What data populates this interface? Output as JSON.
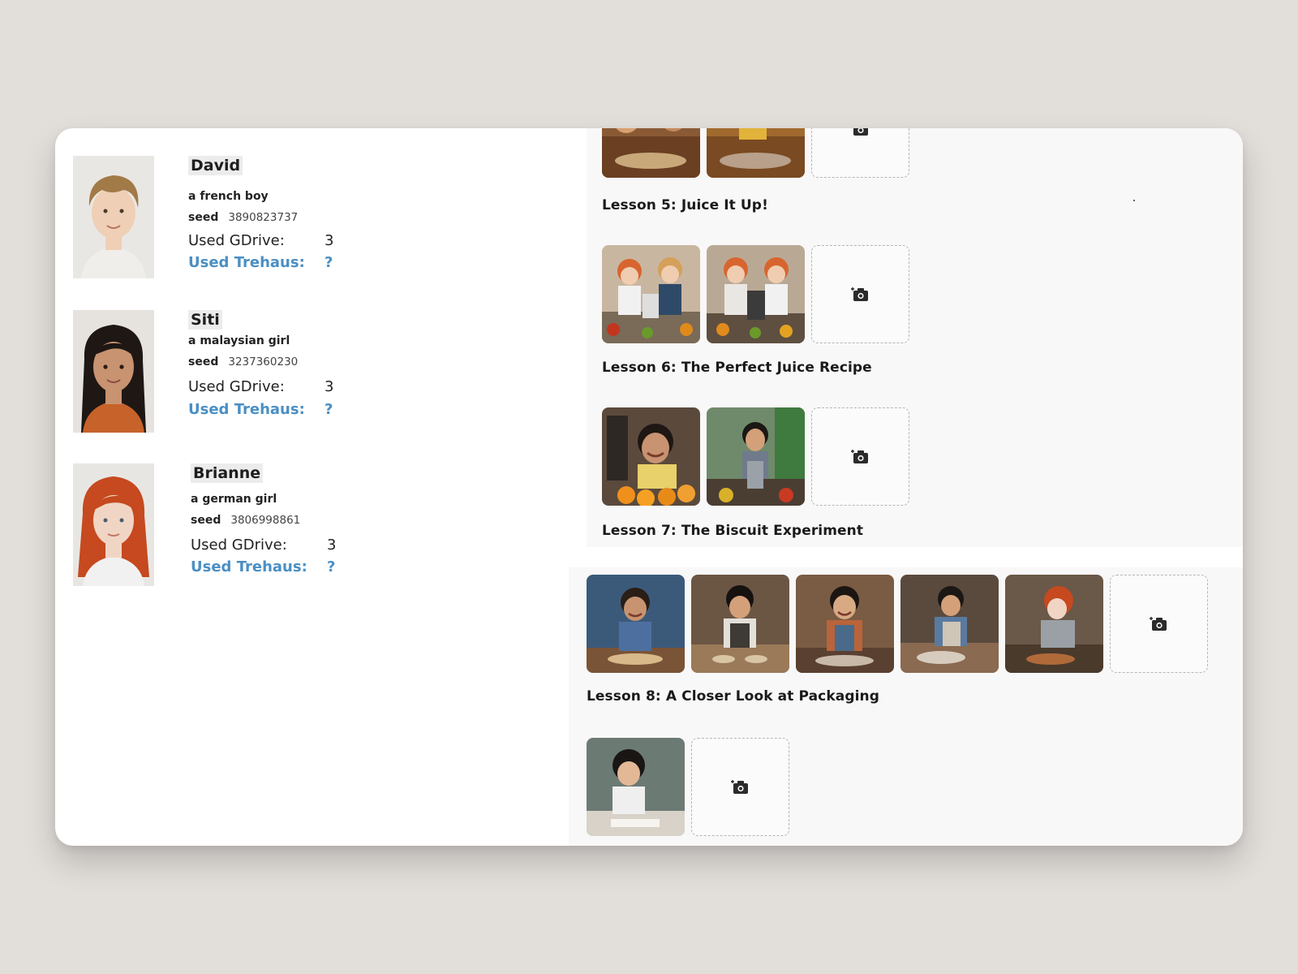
{
  "characters": [
    {
      "name": "David",
      "description": "a french boy",
      "seed_label": "seed",
      "seed": "3890823737",
      "gdrive_label": "Used GDrive:",
      "gdrive_count": "3",
      "trehaus_label": "Used Trehaus:",
      "trehaus_count": "?",
      "portrait_hair": "#a27a47",
      "portrait_shirt": "#efeeeb",
      "portrait_skin": "#efcfb5"
    },
    {
      "name": "Siti",
      "description": "a malaysian girl",
      "seed_label": "seed",
      "seed": "3237360230",
      "gdrive_label": "Used GDrive:",
      "gdrive_count": "3",
      "trehaus_label": "Used Trehaus:",
      "trehaus_count": "?",
      "portrait_hair": "#1e1714",
      "portrait_shirt": "#c6622a",
      "portrait_skin": "#c89370"
    },
    {
      "name": "Brianne",
      "description": "a german girl",
      "seed_label": "seed",
      "seed": "3806998861",
      "gdrive_label": "Used GDrive:",
      "gdrive_count": "3",
      "trehaus_label": "Used Trehaus:",
      "trehaus_count": "?",
      "portrait_hair": "#c6491f",
      "portrait_shirt": "#f1f1f1",
      "portrait_skin": "#f1d5c4"
    }
  ],
  "lessons": [
    {
      "title": "Lesson 5: Juice It Up!"
    },
    {
      "title": "Lesson 6: The Perfect Juice Recipe"
    },
    {
      "title": "Lesson 7: The Biscuit Experiment"
    },
    {
      "title": "Lesson 8: A Closer Look at Packaging"
    }
  ],
  "thumbnails": {
    "lesson4": [
      {
        "scene": "cooking-table",
        "tone": "#8a5a35"
      },
      {
        "scene": "cooking-table",
        "tone": "#a06a2e"
      }
    ],
    "lesson5": [
      {
        "scene": "juicer-kids",
        "tone": "#c9b6a0"
      },
      {
        "scene": "juicer-kids",
        "tone": "#b9a994"
      }
    ],
    "lesson6": [
      {
        "scene": "girl-with-oranges",
        "tone": "#5b4a3c"
      },
      {
        "scene": "boy-with-juicer",
        "tone": "#6f8a6a"
      }
    ],
    "lesson7": [
      {
        "scene": "girl-baking",
        "tone": "#3b5a7a"
      },
      {
        "scene": "boy-baking",
        "tone": "#6b5644"
      },
      {
        "scene": "girl-baking",
        "tone": "#7a5b44"
      },
      {
        "scene": "boy-baking",
        "tone": "#5a4a3e"
      },
      {
        "scene": "redhead-baking",
        "tone": "#6a5848"
      }
    ],
    "lesson8": [
      {
        "scene": "girl-at-desk",
        "tone": "#6c7a74"
      }
    ]
  },
  "upload_icon": "add-photo-icon",
  "colors": {
    "accent": "#4a8fc4",
    "background": "#e2deda",
    "panel": "#f9f8f8"
  }
}
